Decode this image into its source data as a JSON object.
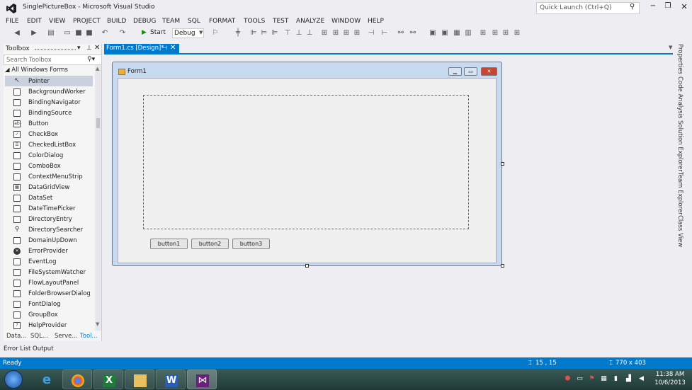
{
  "window": {
    "title": "SinglePictureBox - Microsoft Visual Studio",
    "quick_launch_placeholder": "Quick Launch (Ctrl+Q)"
  },
  "menu": [
    "FILE",
    "EDIT",
    "VIEW",
    "PROJECT",
    "BUILD",
    "DEBUG",
    "TEAM",
    "SQL",
    "FORMAT",
    "TOOLS",
    "TEST",
    "ANALYZE",
    "WINDOW",
    "HELP"
  ],
  "toolbar": {
    "start_label": "Start",
    "config_value": "Debug"
  },
  "toolbox": {
    "title": "Toolbox",
    "search_placeholder": "Search Toolbox",
    "group_label": "All Windows Forms",
    "items": [
      "Pointer",
      "BackgroundWorker",
      "BindingNavigator",
      "BindingSource",
      "Button",
      "CheckBox",
      "CheckedListBox",
      "ColorDialog",
      "ComboBox",
      "ContextMenuStrip",
      "DataGridView",
      "DataSet",
      "DateTimePicker",
      "DirectoryEntry",
      "DirectorySearcher",
      "DomainUpDown",
      "ErrorProvider",
      "EventLog",
      "FileSystemWatcher",
      "FlowLayoutPanel",
      "FolderBrowserDialog",
      "FontDialog",
      "GroupBox",
      "HelpProvider"
    ],
    "selected_item": "Pointer",
    "bottom_tabs": [
      "Data...",
      "SQL...",
      "Serve...",
      "Tool..."
    ]
  },
  "document": {
    "tab_label": "Form1.cs [Design]*"
  },
  "form": {
    "title": "Form1",
    "buttons": [
      "button1",
      "button2",
      "button3"
    ]
  },
  "right_tabs": [
    "Properties",
    "Code Analysis",
    "Solution Explorer",
    "Team Explorer",
    "Class View"
  ],
  "bottom_panel_tabs": [
    "Error List",
    "Output"
  ],
  "status": {
    "text": "Ready",
    "position": "15 , 15",
    "size": "770 x 403"
  },
  "taskbar": {
    "time": "11:38 AM",
    "date": "10/6/2013"
  },
  "colors": {
    "accent": "#007acc",
    "chrome": "#eeeef2"
  }
}
